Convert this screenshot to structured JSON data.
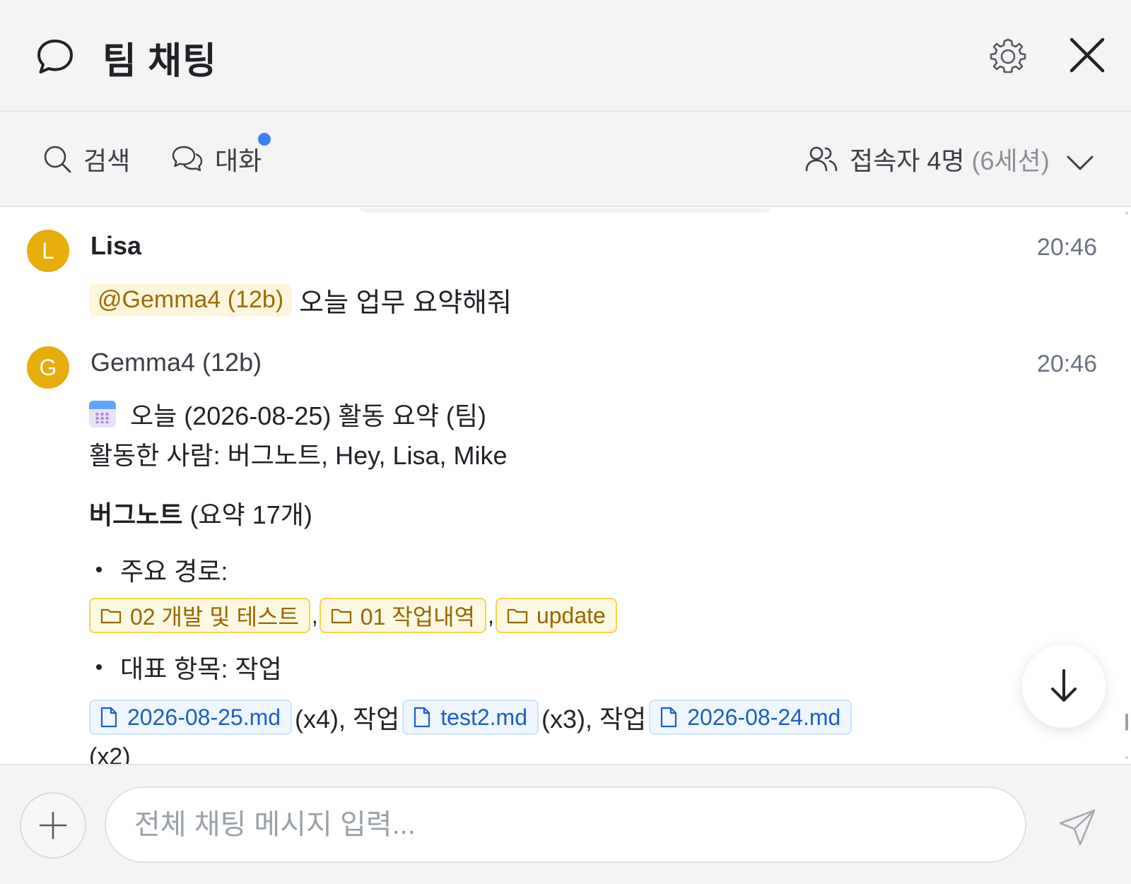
{
  "header": {
    "title": "팀 채팅",
    "icons": {
      "chat": "chat-bubble-icon",
      "settings": "gear-icon",
      "close": "close-icon"
    }
  },
  "toolbar": {
    "search_label": "검색",
    "talk_label": "대화",
    "users_label": "접속자 4명",
    "users_sessions": "(6세션)",
    "icons": {
      "search": "search-icon",
      "talk": "chat-bubbles-icon",
      "users": "users-icon",
      "expand": "chevron-down-icon"
    },
    "accent": "#3b82f6"
  },
  "messages": [
    {
      "avatar": "L",
      "author": "Lisa",
      "time": "20:46",
      "mention": "@Gemma4 (12b)",
      "text": "오늘 업무 요약해줘"
    },
    {
      "avatar": "G",
      "author": "Gemma4 (12b)",
      "time": "20:46",
      "summary_title": "오늘 (2026-08-25) 활동 요약 (팀)",
      "active_people": "활동한 사람: 버그노트, Hey, Lisa, Mike",
      "section_bold": "버그노트",
      "section_rest": "(요약 17개)",
      "bullet_paths": "주요 경로:",
      "folders": [
        "02 개발 및 테스트",
        "01 작업내역",
        "update"
      ],
      "bullet_items": "대표 항목: 작업",
      "files": [
        {
          "name": "2026-08-25.md",
          "count": "(x4), 작업"
        },
        {
          "name": "test2.md",
          "count": "(x3), 작업"
        },
        {
          "name": "2026-08-24.md",
          "count": ""
        }
      ],
      "tail": "(x2)"
    }
  ],
  "colors": {
    "avatar": "#e8ad0b",
    "folder_border": "#f5d547",
    "file_text": "#1f5fbf"
  },
  "composer": {
    "placeholder": "전체 채팅 메시지 입력...",
    "icons": {
      "attach": "plus-icon",
      "send": "send-icon",
      "scroll_down": "arrow-down-icon"
    }
  }
}
